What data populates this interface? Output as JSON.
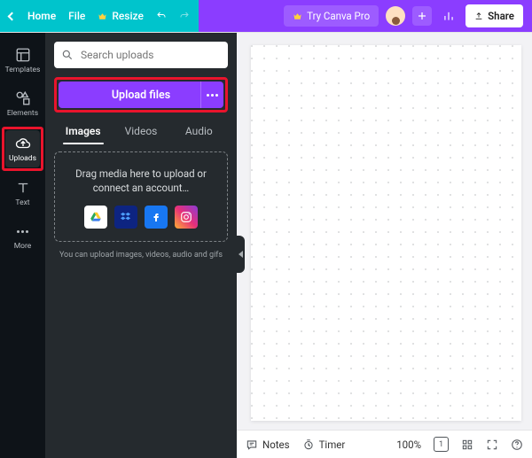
{
  "topbar": {
    "home": "Home",
    "file": "File",
    "resize": "Resize",
    "try_pro": "Try Canva Pro",
    "share": "Share"
  },
  "rail": {
    "templates": "Templates",
    "elements": "Elements",
    "uploads": "Uploads",
    "text": "Text",
    "more": "More"
  },
  "panel": {
    "search_placeholder": "Search uploads",
    "upload_label": "Upload files",
    "tabs": {
      "images": "Images",
      "videos": "Videos",
      "audio": "Audio"
    },
    "drop_text": "Drag media here to upload or connect an account…",
    "hint": "You can upload images, videos, audio and gifs"
  },
  "bottombar": {
    "notes": "Notes",
    "timer": "Timer",
    "zoom": "100%",
    "pagecount": "1"
  }
}
